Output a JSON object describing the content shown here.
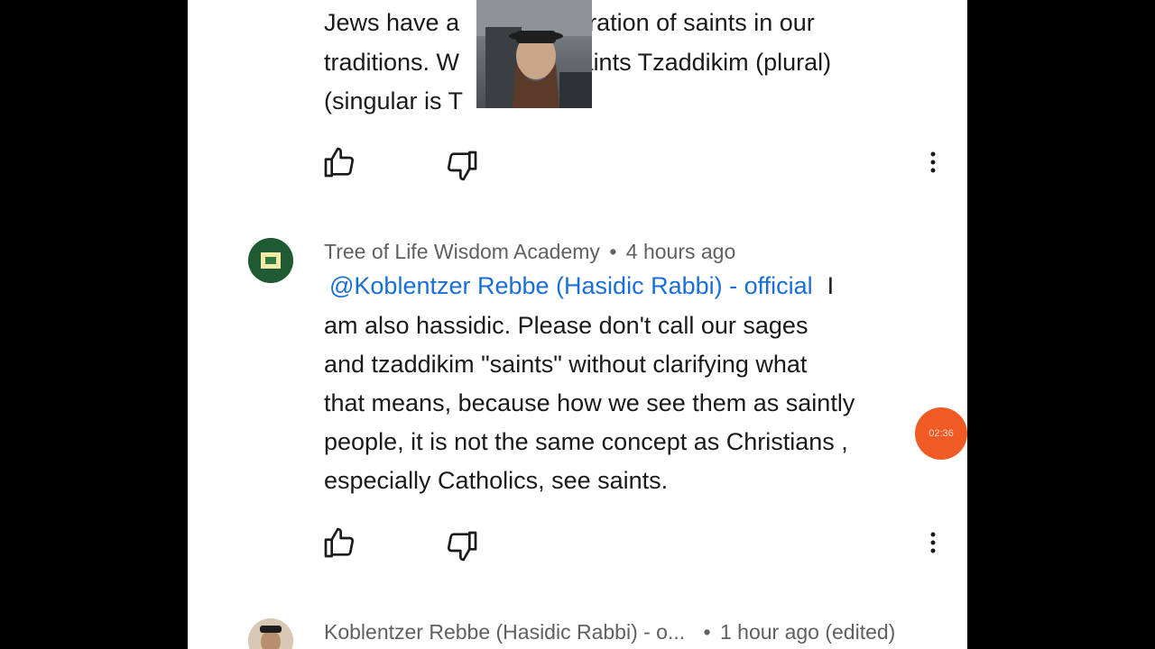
{
  "comment_prev": {
    "line1_a": "Jews have a",
    "line1_b": "eration of saints in our",
    "line2_a": "traditions.  W",
    "line2_b": "saints Tzaddikim (plural)",
    "line3": "(singular is T"
  },
  "comment_main": {
    "author": "Tree of Life Wisdom Academy",
    "separator": "•",
    "time": "4 hours ago",
    "mention": "@Koblentzer Rebbe (Hasidic Rabbi) - official",
    "line1_tail": "I",
    "line2": "am also hassidic.  Please don't call our sages",
    "line3": "and tzaddikim \"saints\" without clarifying what",
    "line4": "that means, because how we see them as saintly",
    "line5": "people, it is not the same concept as Christians ,",
    "line6": "especially Catholics, see saints."
  },
  "comment_next": {
    "author": "Koblentzer Rebbe (Hasidic Rabbi) - o...",
    "separator": "•",
    "time": "1 hour ago (edited)"
  },
  "overlay_badge": "02:36",
  "colors": {
    "mention": "#1a6ed8",
    "badge": "#f05a24",
    "avatar_green": "#1f5a32"
  },
  "icons": [
    "like-icon",
    "dislike-icon",
    "more-vert-icon"
  ]
}
